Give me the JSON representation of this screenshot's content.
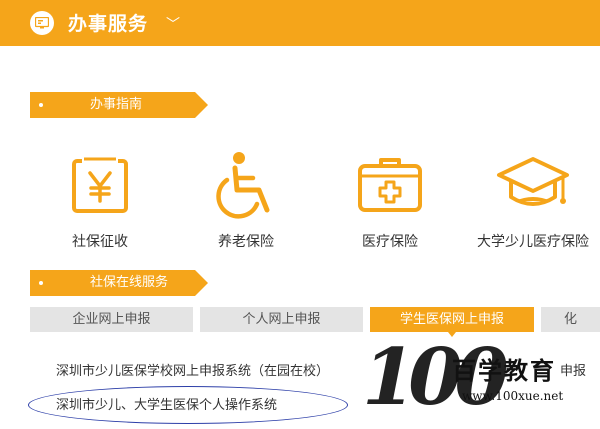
{
  "header": {
    "title": "办事服务",
    "chevron": "﹀",
    "icon": "service-icon"
  },
  "sections": {
    "guide": {
      "label": "办事指南"
    },
    "online": {
      "label": "社保在线服务"
    }
  },
  "services": [
    {
      "label": "社保征收",
      "icon": "yen-icon"
    },
    {
      "label": "养老保险",
      "icon": "wheelchair-icon"
    },
    {
      "label": "医疗保险",
      "icon": "medical-kit-icon"
    },
    {
      "label": "大学少儿医疗保险",
      "icon": "graduation-cap-icon"
    }
  ],
  "tabs": [
    {
      "label": "企业网上申报",
      "active": false
    },
    {
      "label": "个人网上申报",
      "active": false
    },
    {
      "label": "学生医保网上申报",
      "active": true
    },
    {
      "label": "化",
      "active": false
    }
  ],
  "links": {
    "school_system": "深圳市少儿医保学校网上申报系统（在园在校）",
    "personal_system": "深圳市少儿、大学生医保个人操作系统",
    "right_partial": "申报"
  },
  "watermark": {
    "number": "100",
    "name": "百学教育",
    "url": "www.100xue.net"
  },
  "colors": {
    "accent": "#f5a51a",
    "annotation": "#2d3fa8"
  }
}
